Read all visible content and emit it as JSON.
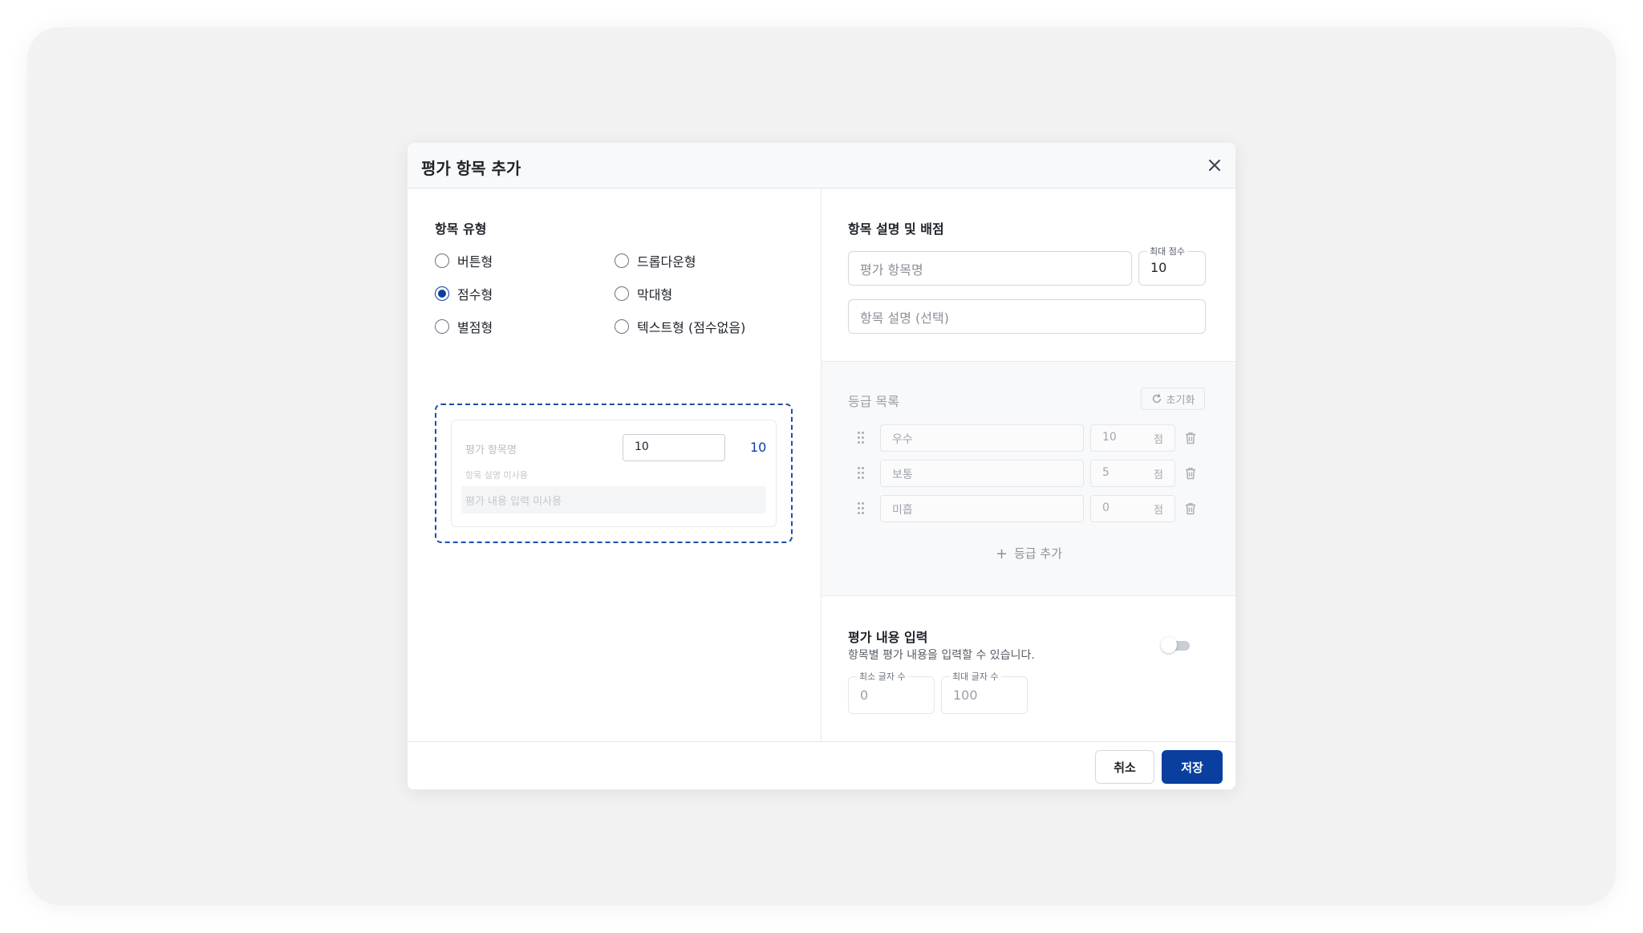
{
  "dialog": {
    "title": "평가 항목 추가"
  },
  "item_type": {
    "label": "항목 유형",
    "options": [
      {
        "label": "버튼형",
        "checked": false
      },
      {
        "label": "드롭다운형",
        "checked": false
      },
      {
        "label": "점수형",
        "checked": true
      },
      {
        "label": "막대형",
        "checked": false
      },
      {
        "label": "별점형",
        "checked": false
      },
      {
        "label": "텍스트형 (점수없음)",
        "checked": false
      }
    ]
  },
  "preview": {
    "name": "평가 항목명",
    "score_value": "10",
    "max_score": "10",
    "description": "항목 설명 미사용",
    "content_input": "평가 내용 입력 미사용"
  },
  "details": {
    "label": "항목 설명 및 배점",
    "name_placeholder": "평가 항목명",
    "max_score_label": "최대 점수",
    "max_score_value": "10",
    "description_placeholder": "항목 설명 (선택)"
  },
  "grades": {
    "label": "등급 목록",
    "reset_label": "초기화",
    "unit": "점",
    "items": [
      {
        "name": "우수",
        "score": "10"
      },
      {
        "name": "보통",
        "score": "5"
      },
      {
        "name": "미흡",
        "score": "0"
      }
    ],
    "add_label": "등급 추가"
  },
  "content_input": {
    "title": "평가 내용 입력",
    "description": "항목별 평가 내용을 입력할 수 있습니다.",
    "enabled": false,
    "min_label": "최소 글자 수",
    "min_value": "0",
    "max_label": "최대 글자 수",
    "max_value": "100"
  },
  "footer": {
    "cancel_label": "취소",
    "save_label": "저장"
  },
  "colors": {
    "primary": "#0a3fa0",
    "border": "#d4d8de",
    "muted": "#9aa0a8"
  }
}
